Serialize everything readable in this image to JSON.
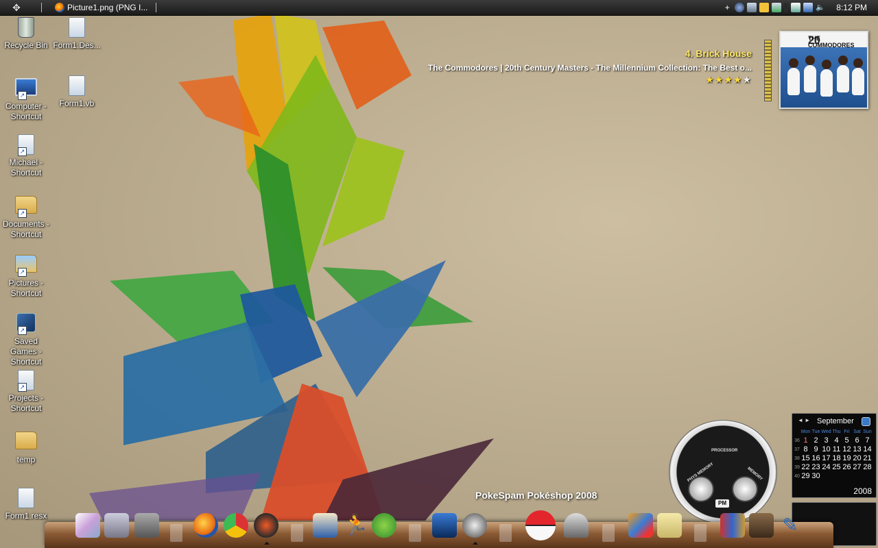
{
  "taskbar": {
    "task_title": "Picture1.png (PNG I...",
    "clock": "8:12 PM",
    "tray_icons": [
      "plus-icon",
      "network-globe-icon",
      "contacts-icon",
      "hex-icon",
      "shield-icon",
      "usb-icon",
      "display-icon",
      "volume-icon"
    ]
  },
  "desktop_icons": [
    {
      "label": "Recycle Bin",
      "icon": "recycle-bin-icon"
    },
    {
      "label": "Form1.Des...",
      "icon": "document-icon"
    },
    {
      "label": "Computer - Shortcut",
      "icon": "computer-icon"
    },
    {
      "label": "Form1.vb",
      "icon": "document-icon"
    },
    {
      "label": "Michael - Shortcut",
      "icon": "user-folder-icon"
    },
    {
      "label": "Documents - Shortcut",
      "icon": "documents-icon"
    },
    {
      "label": "Pictures - Shortcut",
      "icon": "pictures-icon"
    },
    {
      "label": "Saved Games - Shortcut",
      "icon": "games-icon"
    },
    {
      "label": "Projects - Shortcut",
      "icon": "projects-icon"
    },
    {
      "label": "temp",
      "icon": "folder-icon"
    },
    {
      "label": "Form1.resx",
      "icon": "document-icon"
    }
  ],
  "now_playing": {
    "track": "4. Brick House",
    "album": "The Commodores | 20th Century Masters - The Millennium Collection: The Best o...",
    "rating": 4,
    "rating_max": 5,
    "cover_text": "THE COMMODORES",
    "cover_number": "20"
  },
  "calendar": {
    "month": "September",
    "year": "2008",
    "day_names": [
      "Mon",
      "Tue",
      "Wed",
      "Thu",
      "Fri",
      "Sat",
      "Sun"
    ],
    "today": "1",
    "weeks": [
      {
        "wk": "36",
        "days": [
          "1",
          "2",
          "3",
          "4",
          "5",
          "6",
          "7"
        ]
      },
      {
        "wk": "37",
        "days": [
          "8",
          "9",
          "10",
          "11",
          "12",
          "13",
          "14"
        ]
      },
      {
        "wk": "38",
        "days": [
          "15",
          "16",
          "17",
          "18",
          "19",
          "20",
          "21"
        ]
      },
      {
        "wk": "39",
        "days": [
          "22",
          "23",
          "24",
          "25",
          "26",
          "27",
          "28"
        ]
      },
      {
        "wk": "40",
        "days": [
          "29",
          "30",
          "",
          "",
          "",
          "",
          ""
        ]
      }
    ]
  },
  "gauge": {
    "processor_label": "PROCESSOR",
    "phys_label": "PHYS MEMORY",
    "memory_label": "MEMORY",
    "ampm": "PM"
  },
  "dock": {
    "label": "PokeSpam Pokéshop 2008",
    "items": [
      "frame-icon",
      "imac-icon",
      "tools-icon",
      "firefox-icon",
      "chrome-icon",
      "rss-icon",
      "thunderbird-icon",
      "aim-icon",
      "messenger-icon",
      "video-icon",
      "headphones-icon",
      "pokeball-icon",
      "assassin-icon",
      "stripes-icon",
      "notepad-icon",
      "books-icon",
      "portrait-icon",
      "paint-brush-icon"
    ]
  }
}
